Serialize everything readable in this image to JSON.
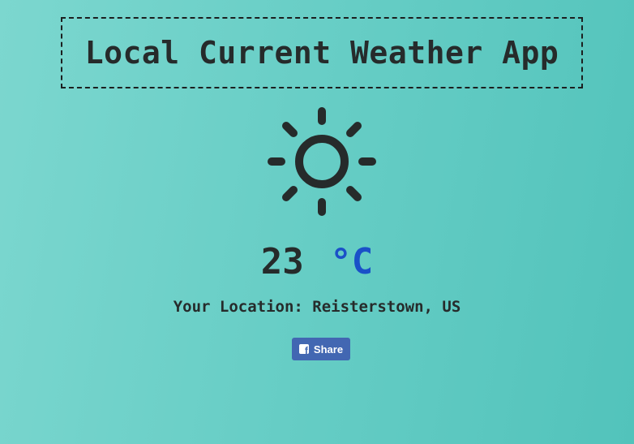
{
  "app": {
    "title": "Local Current Weather App"
  },
  "weather": {
    "icon": "sun-icon",
    "temperature": "23",
    "unit": "°C",
    "location_label": "Your Location: Reisterstown, US"
  },
  "share": {
    "icon": "facebook-icon",
    "label": "Share"
  },
  "colors": {
    "background_start": "#7cd7cf",
    "background_end": "#52c3bb",
    "text": "#262b2b",
    "unit_link": "#1a50c8",
    "share_button": "#4267b2"
  }
}
